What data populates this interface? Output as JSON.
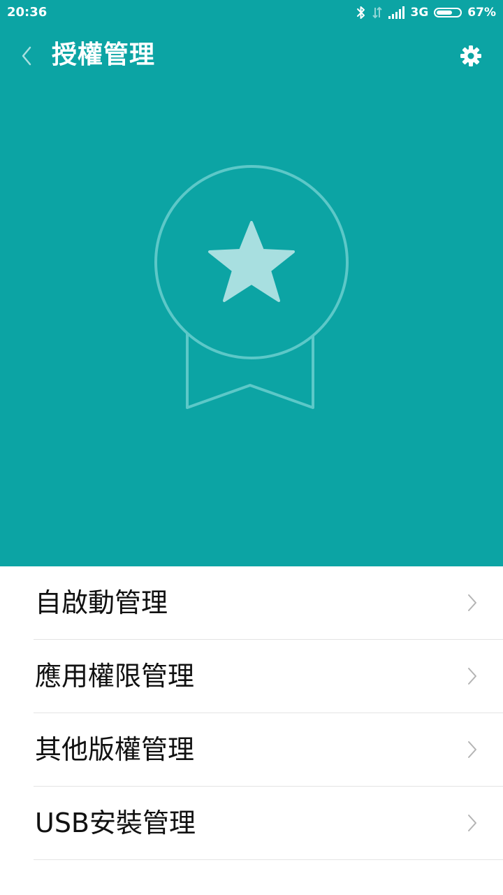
{
  "colors": {
    "primary": "#0ca4a4",
    "medal_stroke": "#5cc8c8",
    "star_fill": "#a8dfe0",
    "text": "#111111",
    "divider": "#e4e4e4",
    "chevron": "#b4b4b4"
  },
  "status_bar": {
    "time": "20:36",
    "network": "3G",
    "battery": "67%",
    "battery_level": 0.67,
    "icons": [
      "bluetooth-icon",
      "data-arrows-icon",
      "signal-bars-icon",
      "battery-icon"
    ]
  },
  "header": {
    "back_icon": "back-chevron-icon",
    "title": "授權管理",
    "settings_icon": "gear-icon"
  },
  "hero": {
    "illustration": "medal-star-icon"
  },
  "menu": {
    "items": [
      {
        "label": "自啟動管理"
      },
      {
        "label": "應用權限管理"
      },
      {
        "label": "其他版權管理"
      },
      {
        "label": "USB安裝管理"
      }
    ]
  }
}
